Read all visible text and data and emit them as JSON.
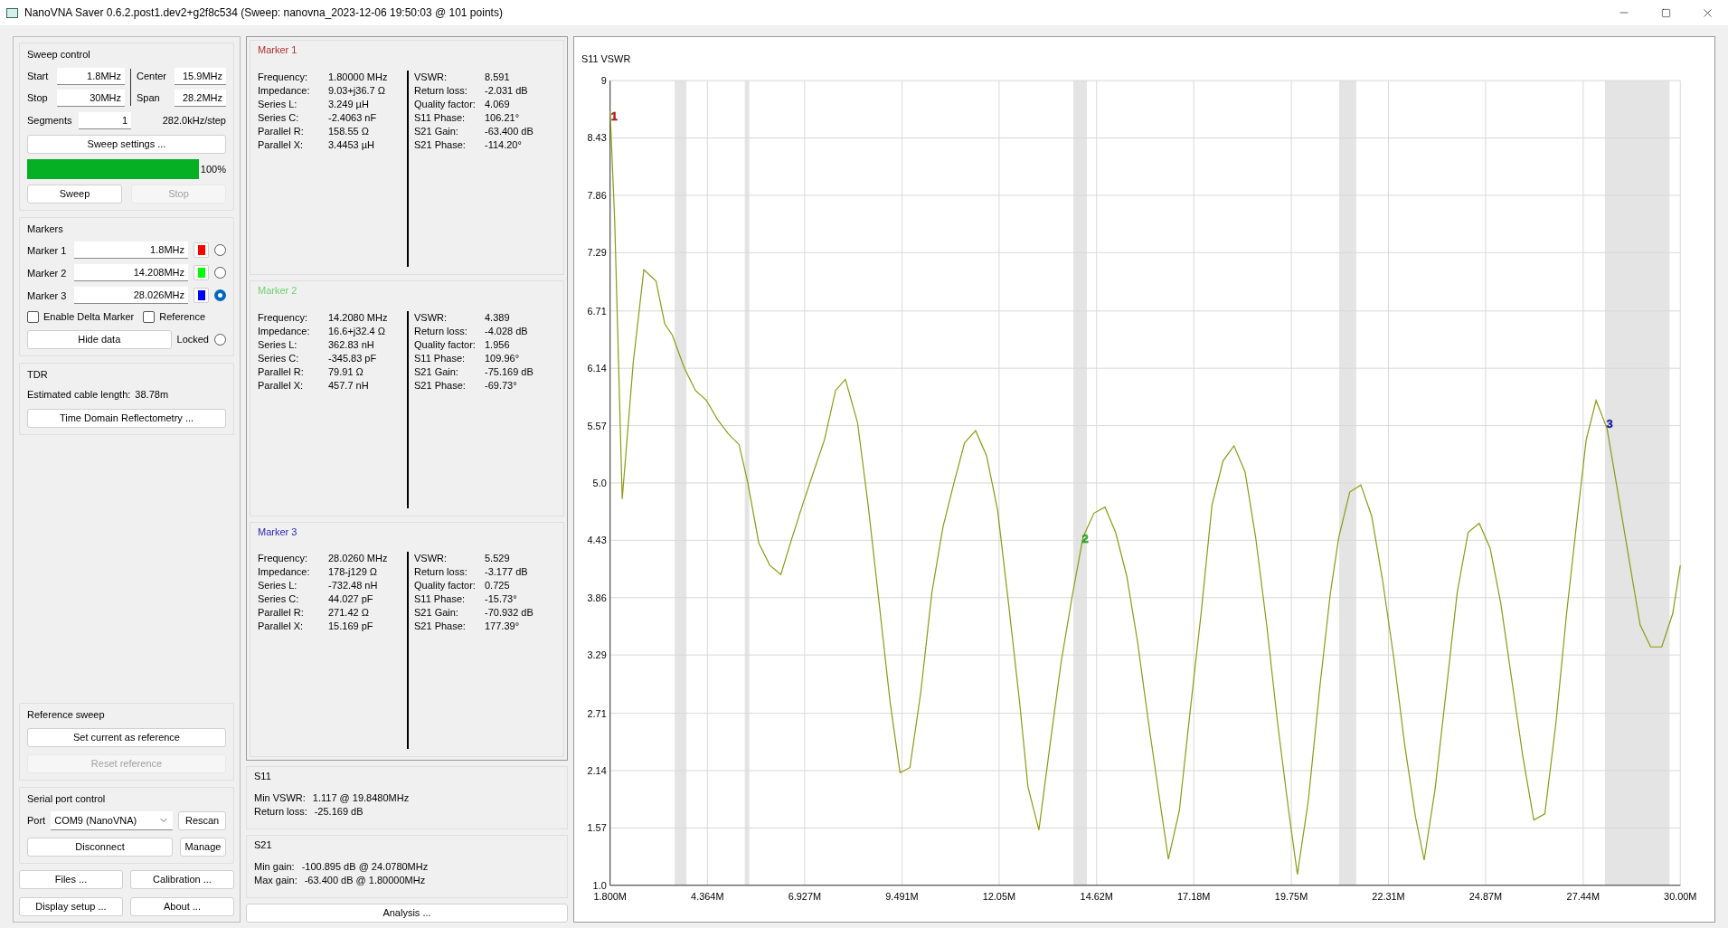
{
  "window": {
    "title": "NanoVNA Saver 0.6.2.post1.dev2+g2f8c534 (Sweep: nanovna_2023-12-06 19:50:03 @ 101 points)"
  },
  "sweep_control": {
    "title": "Sweep control",
    "fields": [
      {
        "label": "Start",
        "value": "1.8MHz"
      },
      {
        "label": "Center",
        "value": "15.9MHz"
      },
      {
        "label": "Stop",
        "value": "30MHz"
      },
      {
        "label": "Span",
        "value": "28.2MHz"
      }
    ],
    "segments": {
      "label": "Segments",
      "value": "1"
    },
    "step": "282.0kHz/step",
    "settings_button": "Sweep settings ...",
    "progress": {
      "level": 1,
      "reading": "100%"
    },
    "buttons": [
      {
        "label": "Sweep",
        "disabled": false
      },
      {
        "label": "Stop",
        "disabled": true
      }
    ]
  },
  "markers": {
    "title": "Markers",
    "items": [
      {
        "label": "Marker 1",
        "value": "1.8MHz",
        "color": "#ff0000",
        "selected": false
      },
      {
        "label": "Marker 2",
        "value": "14.208MHz",
        "color": "#00ff00",
        "selected": false
      },
      {
        "label": "Marker 3",
        "value": "28.026MHz",
        "color": "#0000ff",
        "selected": true
      }
    ],
    "options": [
      {
        "label": "Enable Delta Marker",
        "checked": false
      },
      {
        "label": "Reference",
        "checked": false
      }
    ],
    "hide_button": "Hide data",
    "locked": {
      "label": "Locked",
      "selected": false
    }
  },
  "tdr": {
    "title": "TDR",
    "label": "Estimated cable length:",
    "value": "38.78m",
    "button": "Time Domain Reflectometry ..."
  },
  "reference_sweep": {
    "title": "Reference sweep",
    "buttons": [
      {
        "label": "Set current as reference",
        "disabled": false
      },
      {
        "label": "Reset reference",
        "disabled": true
      }
    ]
  },
  "serial_port": {
    "title": "Serial port control",
    "port_label": "Port",
    "port_value": "COM9 (NanoVNA)",
    "rescan": "Rescan",
    "disconnect": "Disconnect",
    "manage": "Manage"
  },
  "bottom_buttons": [
    "Files ...",
    "Calibration ...",
    "Display setup ...",
    "About ..."
  ],
  "marker_details": [
    {
      "title": "Marker 1",
      "color": "#b03030",
      "left": [
        {
          "label": "Frequency:",
          "value": "1.80000 MHz"
        },
        {
          "label": "Impedance:",
          "value": "9.03+j36.7 Ω"
        },
        {
          "label": "Series L:",
          "value": "3.249 µH"
        },
        {
          "label": "Series C:",
          "value": "-2.4063 nF"
        },
        {
          "label": "Parallel R:",
          "value": "158.55 Ω"
        },
        {
          "label": "Parallel X:",
          "value": "3.4453 µH"
        }
      ],
      "right": [
        {
          "label": "VSWR:",
          "value": "8.591"
        },
        {
          "label": "Return loss:",
          "value": "-2.031 dB"
        },
        {
          "label": "Quality factor:",
          "value": "4.069"
        },
        {
          "label": "S11 Phase:",
          "value": "106.21°"
        },
        {
          "label": "S21 Gain:",
          "value": "-63.400 dB"
        },
        {
          "label": "S21 Phase:",
          "value": "-114.20°"
        }
      ]
    },
    {
      "title": "Marker 2",
      "color": "#70d070",
      "left": [
        {
          "label": "Frequency:",
          "value": "14.2080 MHz"
        },
        {
          "label": "Impedance:",
          "value": "16.6+j32.4 Ω"
        },
        {
          "label": "Series L:",
          "value": "362.83 nH"
        },
        {
          "label": "Series C:",
          "value": "-345.83 pF"
        },
        {
          "label": "Parallel R:",
          "value": "79.91 Ω"
        },
        {
          "label": "Parallel X:",
          "value": "457.7 nH"
        }
      ],
      "right": [
        {
          "label": "VSWR:",
          "value": "4.389"
        },
        {
          "label": "Return loss:",
          "value": "-4.028 dB"
        },
        {
          "label": "Quality factor:",
          "value": "1.956"
        },
        {
          "label": "S11 Phase:",
          "value": "109.96°"
        },
        {
          "label": "S21 Gain:",
          "value": "-75.169 dB"
        },
        {
          "label": "S21 Phase:",
          "value": "-69.73°"
        }
      ]
    },
    {
      "title": "Marker 3",
      "color": "#2828c0",
      "left": [
        {
          "label": "Frequency:",
          "value": "28.0260 MHz"
        },
        {
          "label": "Impedance:",
          "value": "178-j129 Ω"
        },
        {
          "label": "Series L:",
          "value": "-732.48 nH"
        },
        {
          "label": "Series C:",
          "value": "44.027 pF"
        },
        {
          "label": "Parallel R:",
          "value": "271.42 Ω"
        },
        {
          "label": "Parallel X:",
          "value": "15.169 pF"
        }
      ],
      "right": [
        {
          "label": "VSWR:",
          "value": "5.529"
        },
        {
          "label": "Return loss:",
          "value": "-3.177 dB"
        },
        {
          "label": "Quality factor:",
          "value": "0.725"
        },
        {
          "label": "S11 Phase:",
          "value": "-15.73°"
        },
        {
          "label": "S21 Gain:",
          "value": "-70.932 dB"
        },
        {
          "label": "S21 Phase:",
          "value": "177.39°"
        }
      ]
    }
  ],
  "s11": {
    "title": "S11",
    "rows": [
      {
        "label": "Min VSWR:",
        "value": "1.117 @ 19.8480MHz"
      },
      {
        "label": "Return loss:",
        "value": "-25.169 dB"
      }
    ]
  },
  "s21": {
    "title": "S21",
    "rows": [
      {
        "label": "Min gain:",
        "value": "-100.895 dB @ 24.0780MHz"
      },
      {
        "label": "Max gain:",
        "value": "-63.400 dB @ 1.80000MHz"
      }
    ]
  },
  "analysis_button": "Analysis ...",
  "chart": {
    "chart_data": {
      "type": "line",
      "grid": true,
      "x": [
        1.8,
        1.92,
        2.12,
        2.41,
        2.69,
        3.01,
        3.24,
        3.44,
        3.76,
        4.05,
        4.34,
        4.63,
        4.91,
        5.2,
        5.43,
        5.72,
        6.01,
        6.3,
        6.59,
        6.87,
        7.16,
        7.45,
        7.74,
        8.0,
        8.32,
        8.6,
        8.89,
        9.18,
        9.44,
        9.7,
        9.99,
        10.28,
        10.57,
        10.86,
        11.14,
        11.43,
        11.72,
        12.01,
        12.3,
        12.59,
        12.81,
        13.1,
        13.39,
        13.68,
        13.97,
        14.26,
        14.55,
        14.84,
        15.12,
        15.41,
        15.7,
        15.99,
        16.28,
        16.51,
        16.8,
        17.08,
        17.37,
        17.66,
        17.95,
        18.24,
        18.53,
        18.81,
        19.1,
        19.39,
        19.68,
        19.91,
        20.2,
        20.49,
        20.78,
        21.0,
        21.29,
        21.58,
        21.87,
        22.16,
        22.45,
        22.74,
        23.02,
        23.25,
        23.54,
        23.83,
        24.12,
        24.41,
        24.7,
        24.99,
        25.27,
        25.56,
        25.85,
        26.14,
        26.43,
        26.72,
        27.0,
        27.29,
        27.52,
        27.78,
        28.07,
        28.36,
        28.65,
        28.94,
        29.22,
        29.51,
        29.8,
        30.0
      ],
      "series": [
        {
          "name": "S11 VSWR",
          "color": "#8c9a10",
          "values": [
            8.7,
            7.61,
            4.84,
            6.2,
            7.12,
            7.01,
            6.58,
            6.47,
            6.14,
            5.92,
            5.82,
            5.63,
            5.49,
            5.38,
            5.0,
            4.4,
            4.18,
            4.09,
            4.45,
            4.78,
            5.11,
            5.43,
            5.92,
            6.03,
            5.6,
            4.78,
            3.8,
            2.82,
            2.12,
            2.17,
            2.93,
            3.91,
            4.56,
            5.0,
            5.4,
            5.52,
            5.27,
            4.73,
            3.8,
            2.82,
            1.98,
            1.55,
            2.39,
            3.21,
            3.86,
            4.46,
            4.7,
            4.76,
            4.51,
            4.08,
            3.42,
            2.61,
            1.85,
            1.26,
            1.74,
            2.72,
            3.69,
            4.78,
            5.22,
            5.37,
            5.11,
            4.46,
            3.59,
            2.61,
            1.74,
            1.11,
            1.85,
            2.93,
            3.91,
            4.46,
            4.91,
            4.98,
            4.67,
            4.02,
            3.26,
            2.39,
            1.68,
            1.25,
            1.96,
            2.93,
            3.91,
            4.51,
            4.6,
            4.35,
            3.8,
            3.04,
            2.28,
            1.65,
            1.71,
            2.61,
            3.69,
            4.67,
            5.43,
            5.82,
            5.54,
            4.89,
            4.24,
            3.59,
            3.37,
            3.37,
            3.7,
            4.18
          ]
        }
      ],
      "xlim": [
        1.8,
        30.0
      ],
      "ylim": [
        1.0,
        9.0
      ],
      "xticks": [
        {
          "value": 1.8,
          "label": "1.800M"
        },
        {
          "value": 4.364,
          "label": "4.364M"
        },
        {
          "value": 6.927,
          "label": "6.927M"
        },
        {
          "value": 9.491,
          "label": "9.491M"
        },
        {
          "value": 12.05,
          "label": "12.05M"
        },
        {
          "value": 14.62,
          "label": "14.62M"
        },
        {
          "value": 17.18,
          "label": "17.18M"
        },
        {
          "value": 19.75,
          "label": "19.75M"
        },
        {
          "value": 22.31,
          "label": "22.31M"
        },
        {
          "value": 24.87,
          "label": "24.87M"
        },
        {
          "value": 27.44,
          "label": "27.44M"
        },
        {
          "value": 30.0,
          "label": "30.00M"
        }
      ],
      "yticks": [
        {
          "value": 1.0,
          "label": "1.0"
        },
        {
          "value": 1.57,
          "label": "1.57"
        },
        {
          "value": 2.14,
          "label": "2.14"
        },
        {
          "value": 2.71,
          "label": "2.71"
        },
        {
          "value": 3.29,
          "label": "3.29"
        },
        {
          "value": 3.86,
          "label": "3.86"
        },
        {
          "value": 4.43,
          "label": "4.43"
        },
        {
          "value": 5.0,
          "label": "5.0"
        },
        {
          "value": 5.57,
          "label": "5.57"
        },
        {
          "value": 6.14,
          "label": "6.14"
        },
        {
          "value": 6.71,
          "label": "6.71"
        },
        {
          "value": 7.29,
          "label": "7.29"
        },
        {
          "value": 7.86,
          "label": "7.86"
        },
        {
          "value": 8.43,
          "label": "8.43"
        },
        {
          "value": 9.0,
          "label": "9"
        }
      ],
      "annotations": [
        {
          "text": "1",
          "x": 1.8,
          "y": 8.591
        },
        {
          "text": "2",
          "x": 14.208,
          "y": 4.389
        },
        {
          "text": "3",
          "x": 28.026,
          "y": 5.529
        }
      ]
    }
  }
}
